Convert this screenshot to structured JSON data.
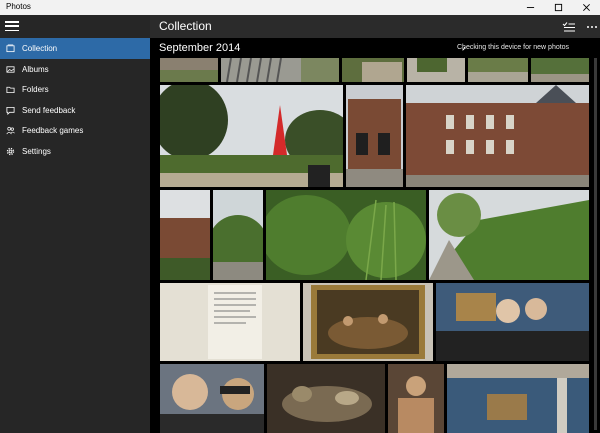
{
  "window": {
    "title": "Photos"
  },
  "sidebar": {
    "items": [
      {
        "label": "Collection",
        "icon": "collection-icon",
        "active": true
      },
      {
        "label": "Albums",
        "icon": "albums-icon"
      },
      {
        "label": "Folders",
        "icon": "folder-icon"
      },
      {
        "label": "Send feedback",
        "icon": "feedback-icon"
      },
      {
        "label": "Feedback games",
        "icon": "people-icon"
      },
      {
        "label": "Settings",
        "icon": "gear-icon"
      }
    ]
  },
  "header": {
    "title": "Collection"
  },
  "main": {
    "section_title": "September 2014",
    "status": "Checking this device for new photos",
    "accent": "#2d6aa7"
  }
}
